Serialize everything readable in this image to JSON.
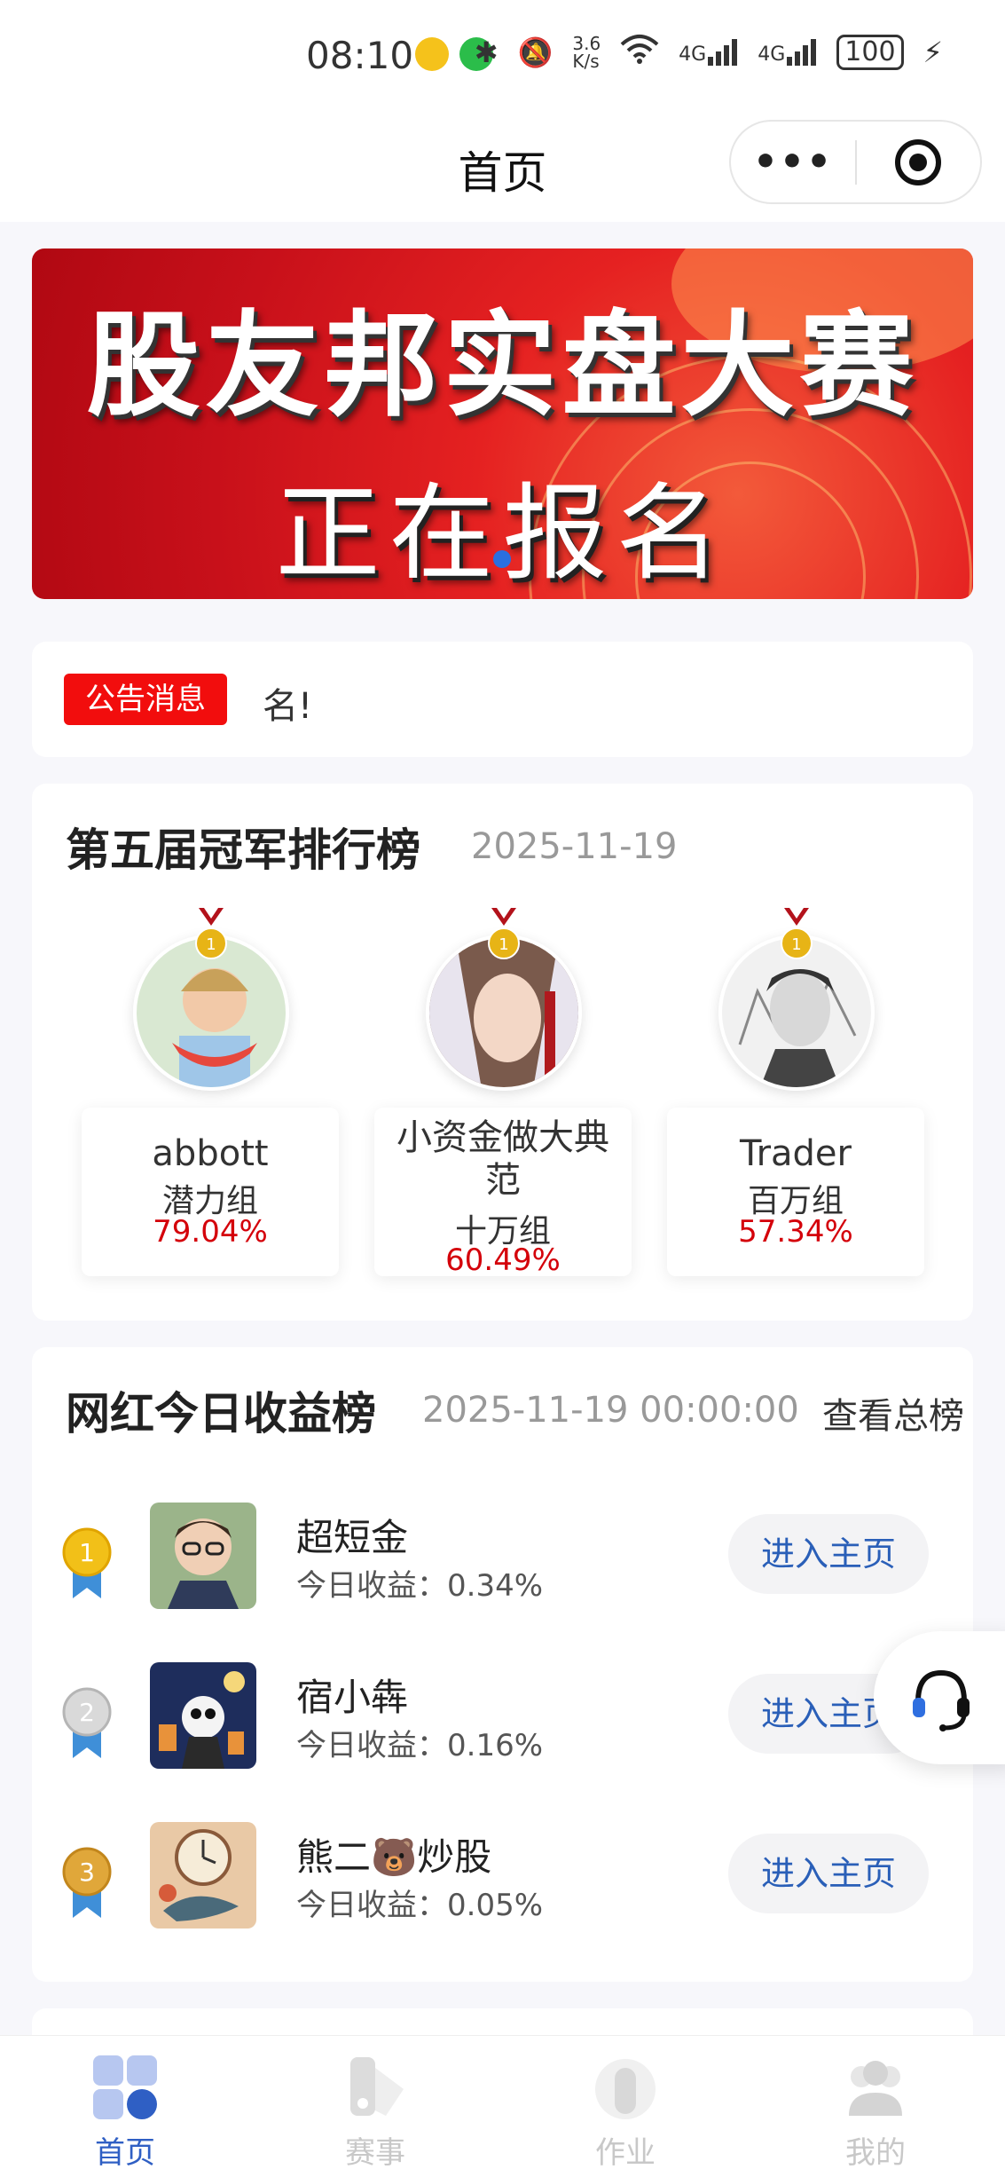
{
  "status_bar": {
    "time": "08:10",
    "network_speed_top": "3.6",
    "network_speed_bottom": "K/s",
    "signal1": "4G",
    "signal2": "4G",
    "battery": "100"
  },
  "nav": {
    "title": "首页",
    "more_label": "•••"
  },
  "banner": {
    "line1": "股友邦实盘大赛",
    "line2": "正在报名"
  },
  "notice": {
    "tag": "公告消息",
    "text": "名!"
  },
  "champion_board": {
    "title": "第五届冠军排行榜",
    "date": "2025-11-19",
    "medal_number": "1",
    "entries": [
      {
        "name": "abbott",
        "group": "潜力组",
        "return": "79.04%"
      },
      {
        "name": "小资金做大典范",
        "group": "十万组",
        "return": "60.49%"
      },
      {
        "name": "Trader",
        "group": "百万组",
        "return": "57.34%"
      }
    ]
  },
  "influencer_board": {
    "title": "网红今日收益榜",
    "date": "2025-11-19 00:00:00",
    "view_all": "查看总榜",
    "rows": [
      {
        "rank": "1",
        "name": "超短金",
        "gain": "今日收益：0.34%",
        "button": "进入主页"
      },
      {
        "rank": "2",
        "name": "宿小犇",
        "gain": "今日收益：0.16%",
        "button": "进入主页"
      },
      {
        "rank": "3",
        "name": "熊二🐻炒股",
        "gain": "今日收益：0.05%",
        "button": "进入主页"
      }
    ]
  },
  "tabbar": {
    "items": [
      {
        "label": "首页",
        "active": true
      },
      {
        "label": "赛事",
        "active": false
      },
      {
        "label": "作业",
        "active": false
      },
      {
        "label": "我的",
        "active": false
      }
    ]
  },
  "colors": {
    "accent_blue": "#2f5fc4",
    "notice_red": "#f20d0d",
    "return_red": "#d4000a",
    "gold": "#e7b416",
    "silver": "#c9c9c9",
    "bronze": "#d39a2c"
  }
}
